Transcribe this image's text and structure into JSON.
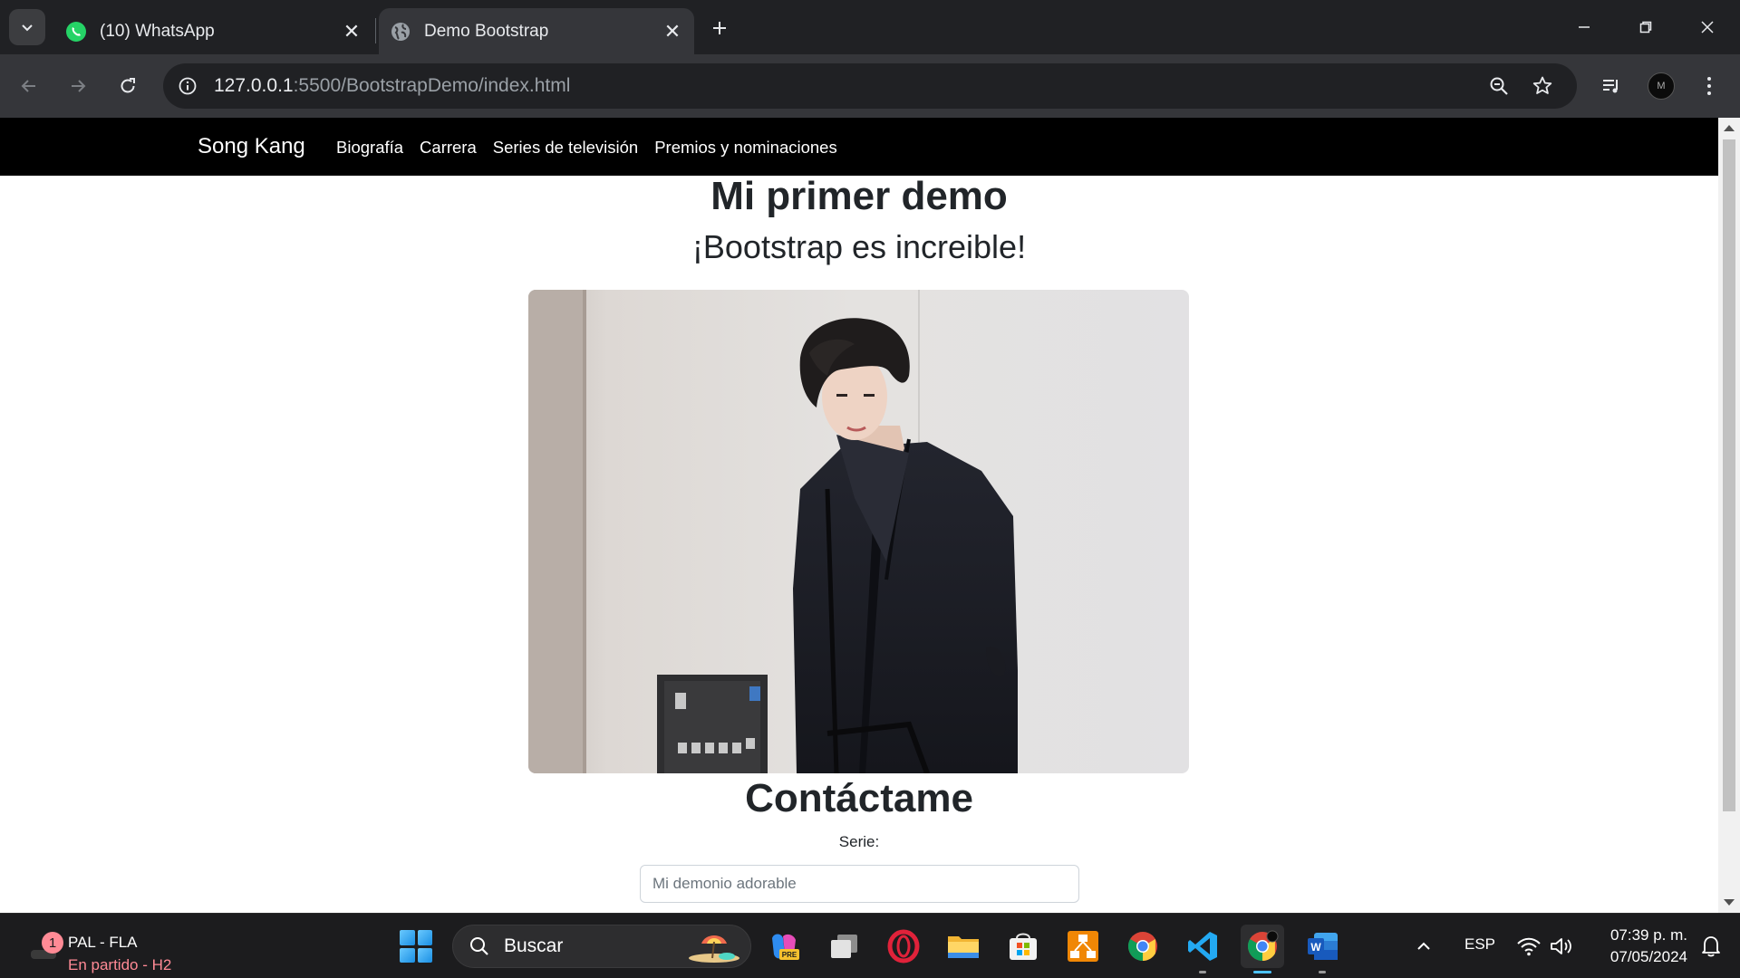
{
  "browser": {
    "tabs": [
      {
        "title": "(10) WhatsApp",
        "active": false
      },
      {
        "title": "Demo Bootstrap",
        "active": true
      }
    ],
    "url_host": "127.0.0.1",
    "url_rest": ":5500/BootstrapDemo/index.html"
  },
  "page": {
    "navbar": {
      "brand": "Song Kang",
      "links": [
        "Biografía",
        "Carrera",
        "Series de televisión",
        "Premios y nominaciones"
      ]
    },
    "title": "Mi primer demo",
    "subtitle": "¡Bootstrap es increible!",
    "contact_title": "Contáctame",
    "form": {
      "label": "Serie:",
      "placeholder": "Mi demonio adorable"
    }
  },
  "taskbar": {
    "widget": {
      "badge": "1",
      "line1": "PAL - FLA",
      "line2": "En partido - H2"
    },
    "search_placeholder": "Buscar",
    "language": "ESP",
    "time": "07:39 p. m.",
    "date": "07/05/2024"
  },
  "colors": {
    "navbar_bg": "#000000",
    "browser_frame": "#202124",
    "toolbar": "#35363a",
    "taskbar": "#1c1c1e",
    "widget_accent": "#ff8a95"
  }
}
